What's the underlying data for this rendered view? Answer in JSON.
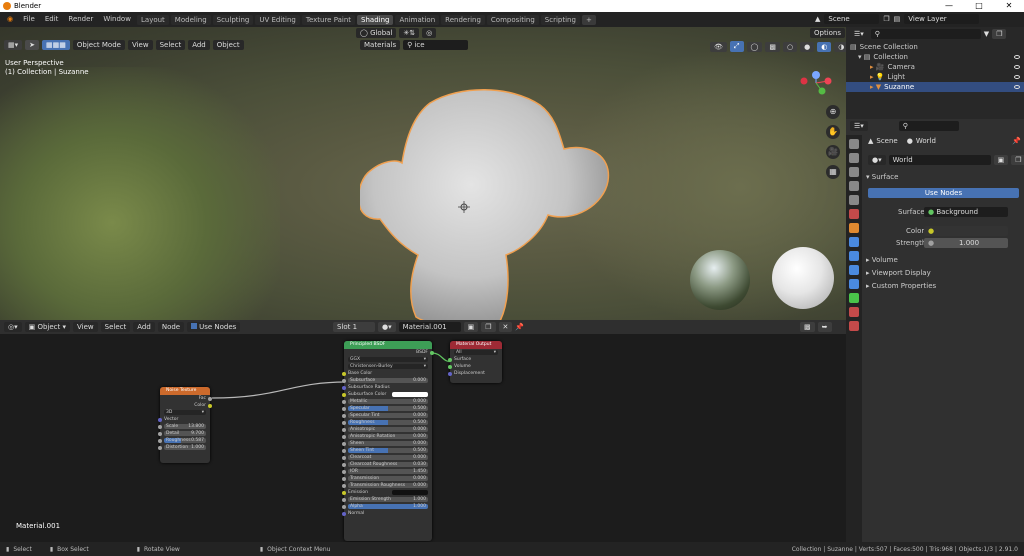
{
  "window": {
    "title": "Blender",
    "controls": [
      "—",
      "□",
      "✕"
    ]
  },
  "menu": [
    "File",
    "Edit",
    "Render",
    "Window",
    "Help"
  ],
  "workspaces": [
    "Layout",
    "Modeling",
    "Sculpting",
    "UV Editing",
    "Texture Paint",
    "Shading",
    "Animation",
    "Rendering",
    "Compositing",
    "Scripting",
    "+"
  ],
  "active_workspace": "Shading",
  "scene": "Scene",
  "view_layer": "View Layer",
  "viewport": {
    "mode": "Object Mode",
    "menus": [
      "View",
      "Select",
      "Add",
      "Object"
    ],
    "orientation": "Global",
    "options": "Options",
    "materials_label": "Materials",
    "search": "ice",
    "overlay_line1": "User Perspective",
    "overlay_line2": "(1) Collection | Suzanne",
    "tools": [
      "⊕",
      "✋",
      "🎥",
      "▦"
    ]
  },
  "node_editor": {
    "object_type": "Object",
    "menus": [
      "View",
      "Select",
      "Add",
      "Node"
    ],
    "use_nodes": "Use Nodes",
    "slot": "Slot 1",
    "material": "Material.001",
    "bottom_label": "Material.001",
    "noise": {
      "title": "Noise Texture",
      "out": [
        "Fac",
        "Color"
      ],
      "dim": "3D",
      "rows": [
        "Vector"
      ],
      "bars": [
        [
          "Scale",
          "13.800"
        ],
        [
          "Detail",
          "9.700"
        ],
        [
          "Roughness",
          "0.587"
        ],
        [
          "Distortion",
          "1.000"
        ]
      ]
    },
    "bsdf": {
      "title": "Principled BSDF",
      "out": "BSDF",
      "dist": "GGX",
      "sss": "Christensen-Burley",
      "rows": [
        [
          "Base Color",
          ""
        ],
        [
          "Subsurface",
          "0.000"
        ],
        [
          "Subsurface Radius",
          ""
        ],
        [
          "Subsurface Color",
          ""
        ],
        [
          "Metallic",
          "0.000"
        ],
        [
          "Specular",
          "0.500"
        ],
        [
          "Specular Tint",
          "0.000"
        ],
        [
          "Roughness",
          "0.500"
        ],
        [
          "Anisotropic",
          "0.000"
        ],
        [
          "Anisotropic Rotation",
          "0.000"
        ],
        [
          "Sheen",
          "0.000"
        ],
        [
          "Sheen Tint",
          "0.500"
        ],
        [
          "Clearcoat",
          "0.000"
        ],
        [
          "Clearcoat Roughness",
          "0.030"
        ],
        [
          "IOR",
          "1.450"
        ],
        [
          "Transmission",
          "0.000"
        ],
        [
          "Transmission Roughness",
          "0.000"
        ],
        [
          "Emission",
          ""
        ],
        [
          "Emission Strength",
          "1.000"
        ],
        [
          "Alpha",
          "1.000"
        ],
        [
          "Normal",
          ""
        ]
      ]
    },
    "output": {
      "title": "Material Output",
      "target": "All",
      "rows": [
        "Surface",
        "Volume",
        "Displacement"
      ]
    }
  },
  "outliner": {
    "root": "Scene Collection",
    "items": [
      {
        "label": "Collection"
      },
      {
        "label": "Camera"
      },
      {
        "label": "Light"
      },
      {
        "label": "Suzanne"
      }
    ]
  },
  "properties": {
    "breadcrumb1": "Scene",
    "breadcrumb2": "World",
    "world": "World",
    "surface": "Surface",
    "use_nodes": "Use Nodes",
    "surface_label": "Surface",
    "surface_value": "Background",
    "color_label": "Color",
    "strength_label": "Strength",
    "strength_value": "1.000",
    "panels": [
      "Volume",
      "Viewport Display",
      "Custom Properties"
    ]
  },
  "status": {
    "select": "Select",
    "box_select": "Box Select",
    "rotate": "Rotate View",
    "context": "Object Context Menu",
    "info": "Collection | Suzanne | Verts:507 | Faces:500 | Tris:968 | Objects:1/3 | 2.91.0"
  }
}
